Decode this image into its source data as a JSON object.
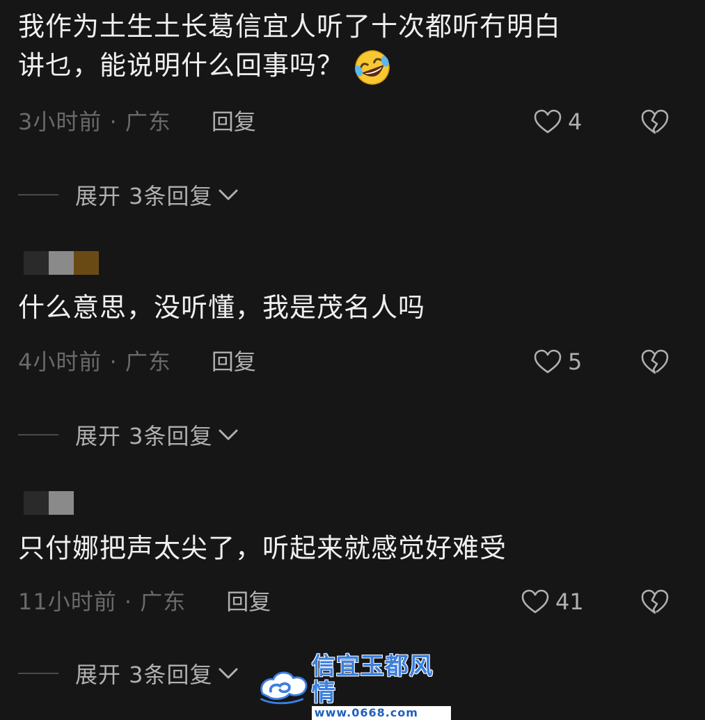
{
  "comments": [
    {
      "text_line1": "我作为土生土长葛信宜人听了十次都听冇明白",
      "text_line2": "讲乜，能说明什么回事吗？",
      "emoji": "rolling-on-floor-laughing-emoji",
      "time_location": "3小时前 · 广东",
      "reply_label": "回复",
      "likes": "4",
      "expand_label": "展开 3条回复"
    },
    {
      "text_line1": "什么意思，没听懂，我是茂名人吗",
      "time_location": "4小时前 · 广东",
      "reply_label": "回复",
      "likes": "5",
      "expand_label": "展开 3条回复"
    },
    {
      "text_line1": "只付娜把声太尖了，听起来就感觉好难受",
      "time_location": "11小时前 · 广东",
      "reply_label": "回复",
      "likes": "41",
      "expand_label": "展开 3条回复"
    }
  ],
  "icons": {
    "like": "heart-outline-icon",
    "dislike": "broken-heart-icon",
    "expand": "chevron-down-icon"
  },
  "watermark": {
    "title": "信宜玉都风情",
    "url": "www.0668.com"
  },
  "colors": {
    "background": "#161616",
    "text": "#f0f0f0",
    "muted": "#6a6a6a",
    "secondary": "#b0b0b0",
    "watermark": "#3b7fe0"
  }
}
